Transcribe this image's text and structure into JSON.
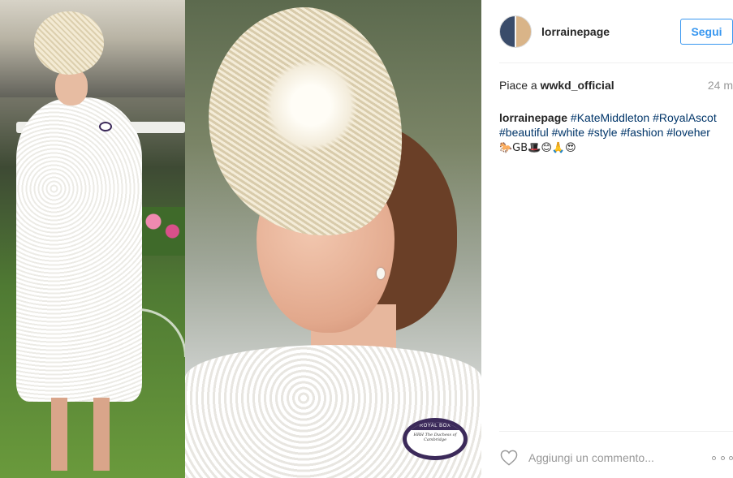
{
  "header": {
    "username": "lorrainepage",
    "follow_label": "Segui"
  },
  "likes": {
    "prefix": "Piace a",
    "liker": "wwkd_official",
    "time": "24 m"
  },
  "caption": {
    "username": "lorrainepage",
    "hashtags": [
      "#KateMiddleton",
      "#RoyalAscot",
      "#beautiful",
      "#white",
      "#style",
      "#fashion",
      "#loveher"
    ],
    "emoji": "🐎GB🎩😊🙏😍"
  },
  "photo": {
    "badge_title": "ROYAL BOX",
    "badge_name": "HRH The Duchess of Cambridge"
  },
  "comment": {
    "placeholder": "Aggiungi un commento..."
  },
  "icons": {
    "like": "heart-icon",
    "more": "more-options-icon",
    "avatar": "avatar"
  },
  "colors": {
    "accent": "#3897f0",
    "hashtag": "#003569",
    "muted": "#999999"
  }
}
